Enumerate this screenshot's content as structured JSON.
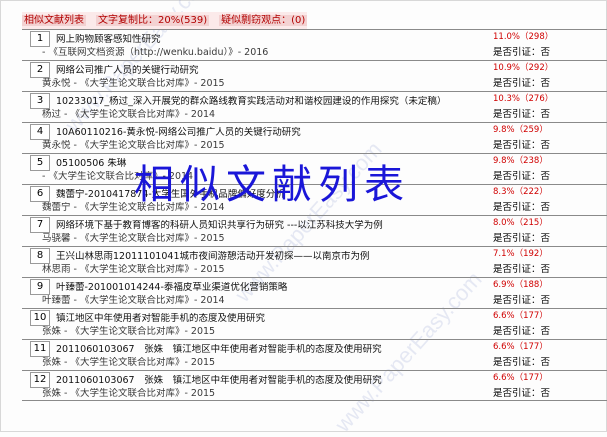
{
  "header": {
    "label": "相似文献列表",
    "ratio_label": "文字复制比：20%(539)",
    "suspect_label": "疑似剽窃观点：(0)"
  },
  "overlay_title": "相似文献列表",
  "watermark": "www.PaperEasy.com",
  "rows": [
    {
      "num": "1",
      "title": "网上购物顾客感知性研究",
      "source": "- 《互联网文档资源（http://wenku.baidu）》- 2016",
      "pct": "11.0%（298）",
      "cite": "是否引证：否"
    },
    {
      "num": "2",
      "title": "网络公司推广人员的关键行动研究",
      "source": "黄永悦 - 《大学生论文联合比对库》- 2015",
      "pct": "10.9%（292）",
      "cite": "是否引证：否"
    },
    {
      "num": "3",
      "title": "10233017_杨过_深入开展党的群众路线教育实践活动对和谐校园建设的作用探究（未定稿）",
      "source": "杨过 - 《大学生论文联合比对库》- 2014",
      "pct": "10.3%（276）",
      "cite": "是否引证：否"
    },
    {
      "num": "4",
      "title": "10A60110216-黄永悦-网络公司推广人员的关键行动研究",
      "source": "黄永悦 - 《大学生论文联合比对库》- 2015",
      "pct": "9.8%（259）",
      "cite": "是否引证：否"
    },
    {
      "num": "5",
      "title": "05100506 朱琳",
      "source": "- 《大学生论文联合比对库》- 2014",
      "pct": "9.8%（238）",
      "cite": "是否引证：否"
    },
    {
      "num": "6",
      "title": "魏蕾宁-2010417874-大学生国外手机品牌偏好度分析",
      "source": "魏蕾宁 - 《大学生论文联合比对库》- 2014",
      "pct": "8.3%（222）",
      "cite": "是否引证：否"
    },
    {
      "num": "7",
      "title": "网络环境下基于教育博客的科研人员知识共享行为研究 ---以江苏科技大学为例",
      "source": "马骁馨 - 《大学生论文联合比对库》- 2015",
      "pct": "8.0%（215）",
      "cite": "是否引证：否"
    },
    {
      "num": "8",
      "title": "王兴山林思雨12011101041城市夜间游憩活动开发初探——以南京市为例",
      "source": "林思雨 - 《大学生论文联合比对库》- 2015",
      "pct": "7.1%（192）",
      "cite": "是否引证：否"
    },
    {
      "num": "9",
      "title": "叶臻蕾-201001014244-泰福皮草业渠道优化营销策略",
      "source": "叶臻蕾 - 《大学生论文联合比对库》- 2014",
      "pct": "6.9%（188）",
      "cite": "是否引证：否"
    },
    {
      "num": "10",
      "title": "镇江地区中年使用者对智能手机的态度及使用研究",
      "source": "张姝 - 《大学生论文联合比对库》- 2015",
      "pct": "6.6%（177）",
      "cite": "是否引证：否"
    },
    {
      "num": "11",
      "title": "2011060103067　张姝　镇江地区中年使用者对智能手机的态度及使用研究",
      "source": "张姝 - 《大学生论文联合比对库》- 2015",
      "pct": "6.6%（177）",
      "cite": "是否引证：否"
    },
    {
      "num": "12",
      "title": "2011060103067　张姝　镇江地区中年使用者对智能手机的态度及使用研究",
      "source": "张姝 - 《大学生论文联合比对库》- 2015",
      "pct": "6.6%（177）",
      "cite": "是否引证：否"
    }
  ]
}
